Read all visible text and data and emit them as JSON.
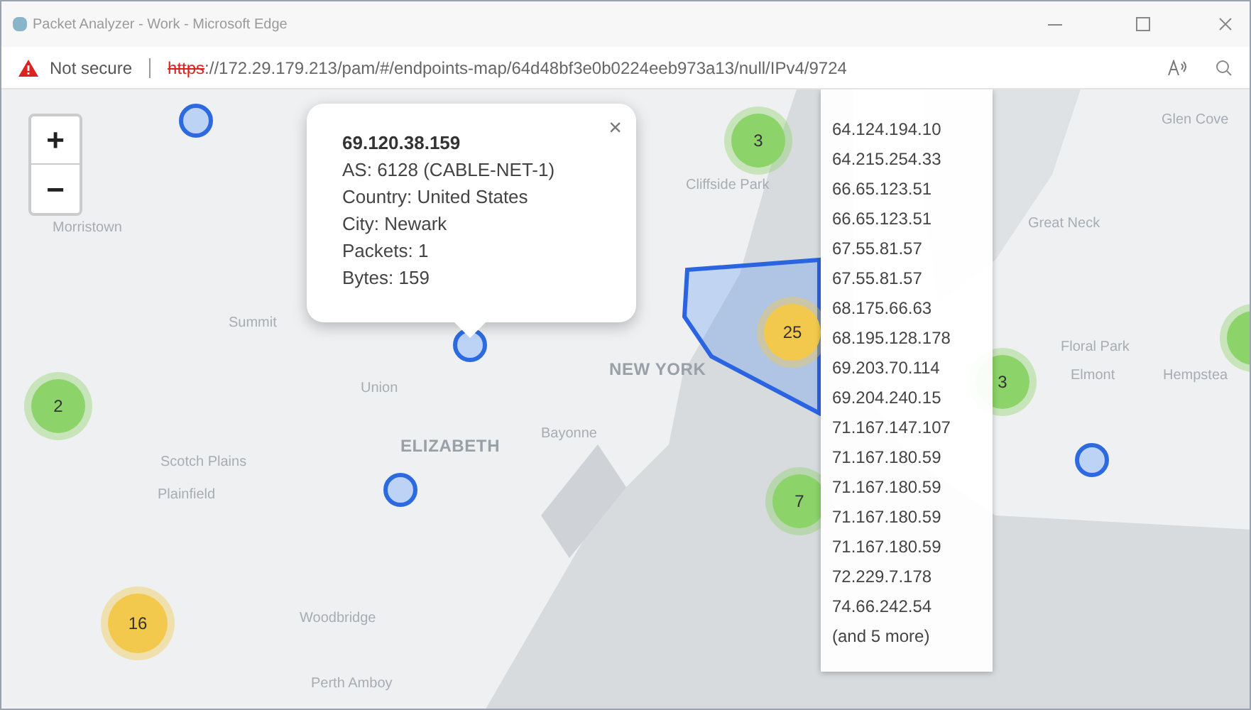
{
  "window": {
    "title": "Packet Analyzer - Work - Microsoft Edge"
  },
  "address_bar": {
    "security": "Not secure",
    "scheme": "https",
    "url_rest": "://172.29.179.213/pam/#/endpoints-map/64d48bf3e0b0224eeb973a13/null/IPv4/9724"
  },
  "map": {
    "place_labels": [
      {
        "text": "Morristown",
        "kind": "town"
      },
      {
        "text": "Summit",
        "kind": "town"
      },
      {
        "text": "Union",
        "kind": "town"
      },
      {
        "text": "ELIZABETH",
        "kind": "city"
      },
      {
        "text": "Bayonne",
        "kind": "town"
      },
      {
        "text": "Scotch Plains",
        "kind": "town"
      },
      {
        "text": "Plainfield",
        "kind": "town"
      },
      {
        "text": "Woodbridge",
        "kind": "town"
      },
      {
        "text": "Perth Amboy",
        "kind": "town"
      },
      {
        "text": "Cliffside Park",
        "kind": "town"
      },
      {
        "text": "NEW YORK",
        "kind": "city"
      },
      {
        "text": "Great Neck",
        "kind": "town"
      },
      {
        "text": "Glen Cove",
        "kind": "town"
      },
      {
        "text": "Floral Park",
        "kind": "town"
      },
      {
        "text": "Elmont",
        "kind": "town"
      },
      {
        "text": "Hempstea",
        "kind": "town"
      }
    ],
    "clusters": [
      {
        "count": "3",
        "color": "#8cd36a"
      },
      {
        "count": "2",
        "color": "#8cd36a"
      },
      {
        "count": "25",
        "color": "#f2c94c"
      },
      {
        "count": "16",
        "color": "#f2c94c"
      },
      {
        "count": "7",
        "color": "#8cd36a"
      },
      {
        "count": "3",
        "color": "#8cd36a"
      },
      {
        "color": "#8cd36a"
      }
    ],
    "zoom_controls": [
      "+",
      "−"
    ],
    "popup": {
      "title": "69.120.38.159",
      "lines": [
        "AS: 6128 (CABLE-NET-1)",
        "Country: United States",
        "City: Newark",
        "Packets: 1",
        "Bytes: 159"
      ],
      "close": "×"
    },
    "tooltip_list": [
      "64.124.194.10",
      "64.215.254.33",
      "66.65.123.51",
      "66.65.123.51",
      "67.55.81.57",
      "67.55.81.57",
      "68.175.66.63",
      "68.195.128.178",
      "69.203.70.114",
      "69.204.240.15",
      "71.167.147.107",
      "71.167.180.59",
      "71.167.180.59",
      "71.167.180.59",
      "71.167.180.59",
      "72.229.7.178",
      "74.66.242.54",
      "(and 5 more)"
    ]
  }
}
